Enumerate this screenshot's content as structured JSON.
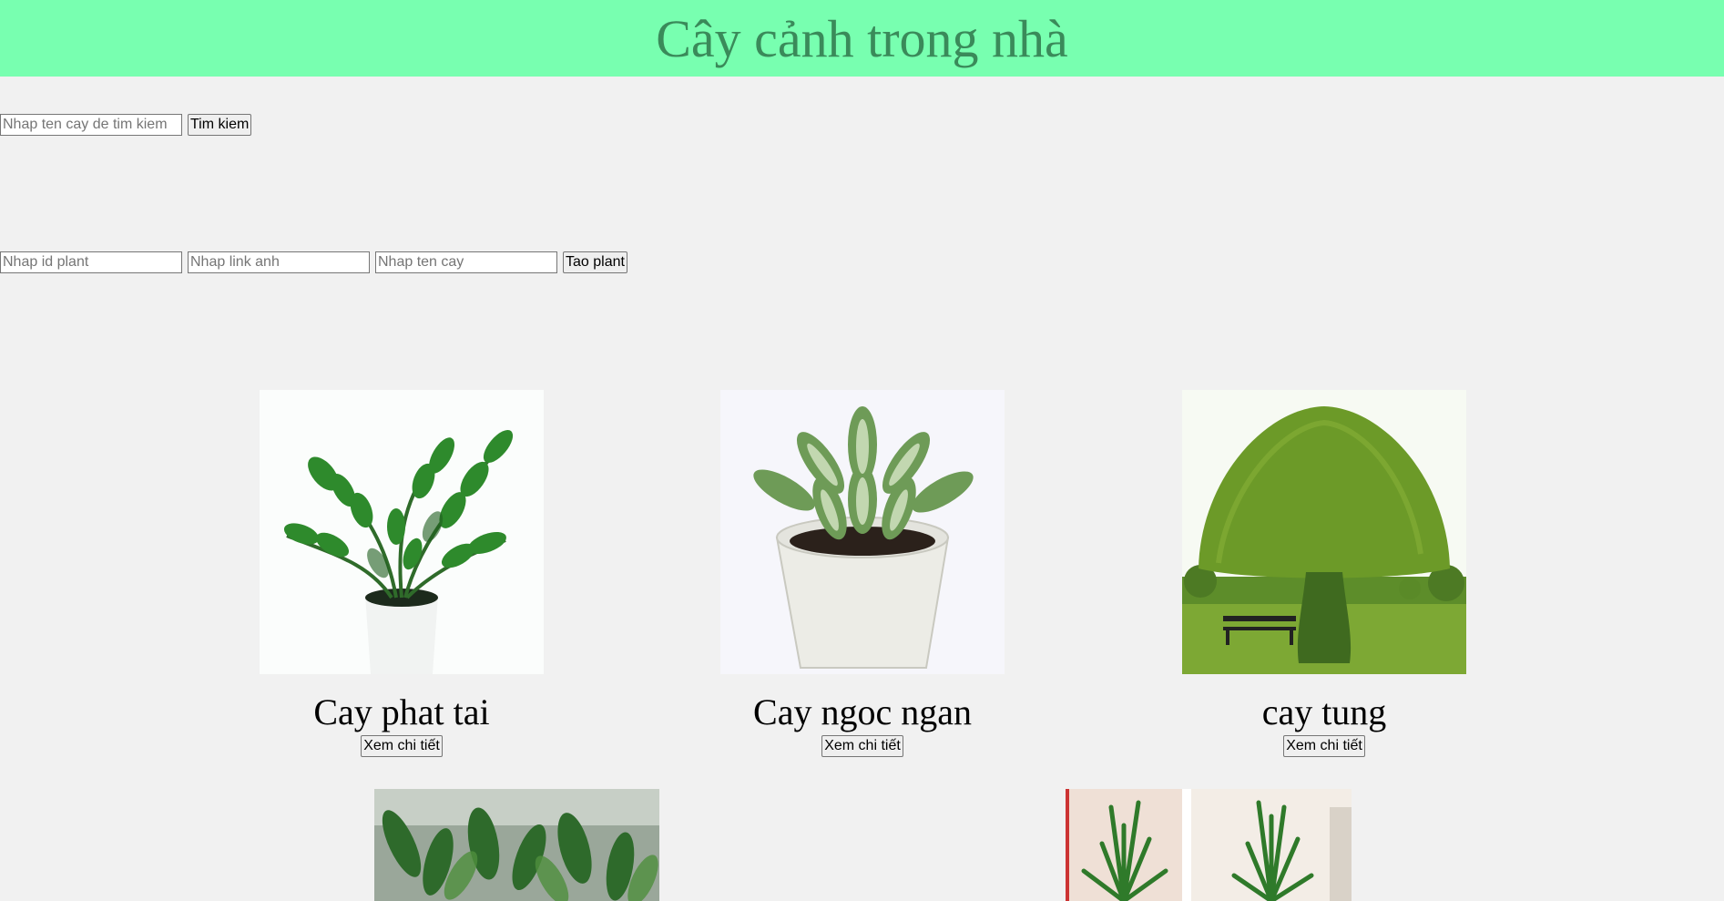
{
  "header": {
    "title": "Cây cảnh trong nhà"
  },
  "search": {
    "placeholder": "Nhap ten cay de tim kiem",
    "value": "",
    "button_label": "Tim kiem"
  },
  "create": {
    "id_placeholder": "Nhap id plant",
    "link_placeholder": "Nhap link anh",
    "name_placeholder": "Nhap ten cay",
    "button_label": "Tao plant"
  },
  "plants": [
    {
      "name": "Cay phat tai",
      "button_label": "Xem chi tiết",
      "image": "zz-plant-photo"
    },
    {
      "name": "Cay ngoc ngan",
      "button_label": "Xem chi tiết",
      "image": "aglaonema-pot-photo"
    },
    {
      "name": "cay tung",
      "button_label": "Xem chi tiết",
      "image": "topiary-tree-photo"
    }
  ],
  "partial_images": [
    {
      "image": "greenhouse-plants-photo"
    },
    {
      "image": "dracaena-pair-photo"
    }
  ],
  "colors": {
    "header_bg": "#78ffb0",
    "header_text": "#3a8a5a",
    "page_bg": "#f1f1f1"
  }
}
